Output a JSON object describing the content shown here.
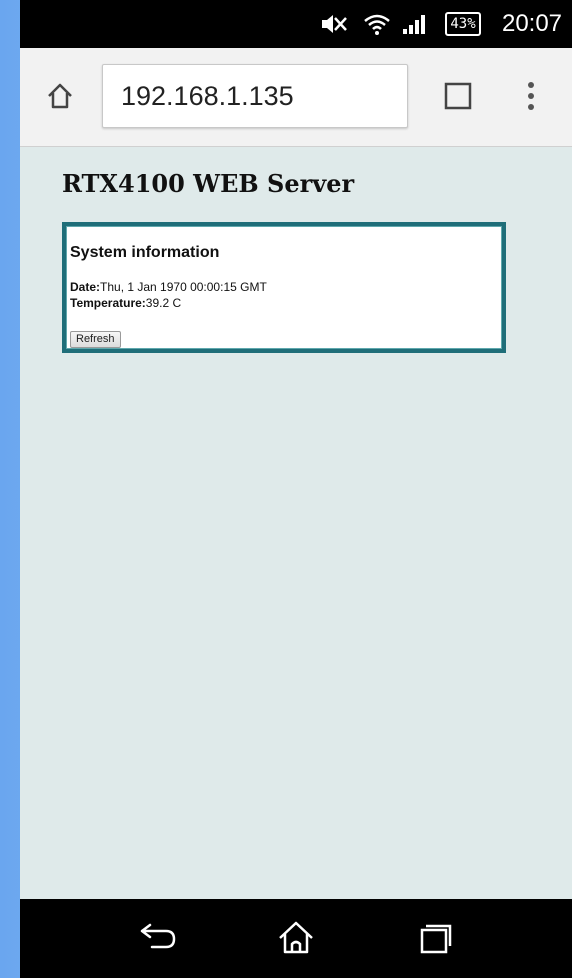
{
  "status_bar": {
    "icons": [
      "mute-icon",
      "wifi-icon",
      "signal-icon"
    ],
    "battery": "43%",
    "time": "20:07"
  },
  "browser": {
    "url": "192.168.1.135",
    "icons": [
      "home-icon",
      "tabs-icon",
      "overflow-menu-icon"
    ]
  },
  "page": {
    "title": "RTX4100 WEB Server",
    "panel": {
      "heading": "System information",
      "date_label": "Date:",
      "date_value": "Thu, 1 Jan 1970 00:00:15 GMT",
      "temp_label": "Temperature:",
      "temp_value": "39.2 C",
      "refresh_label": "Refresh"
    }
  },
  "nav_bar": {
    "icons": [
      "back-icon",
      "home-icon",
      "recent-apps-icon"
    ]
  },
  "colors": {
    "page_background": "#dfeaea",
    "panel_border": "#1f6e79",
    "toolbar_background": "#f2f2f2",
    "system_bars": "#000000"
  }
}
